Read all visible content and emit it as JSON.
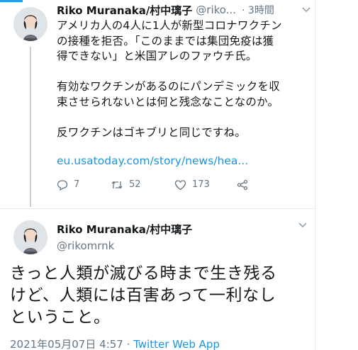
{
  "accent_color": "#1da1f2",
  "link_color": "#1b95e0",
  "tweet1": {
    "author_name": "Riko Muranaka/村中璃子",
    "author_handle": "@riko...",
    "timestamp": "· 3時間",
    "avatar_icon": "avatar-icon",
    "lines": [
      "アメリカ人の4人に1人が新型コロナワクチン",
      "の接種を拒否。「このままでは集団免疫は獲",
      "得できない」と米国アレのファウチ氏。"
    ],
    "lines2": [
      "有効なワクチンがあるのにパンデミックを収",
      "束させられないとは何と残念なことなのか。"
    ],
    "line3": "反ワクチンはゴキブリと同じですね。",
    "link": "eu.usatoday.com/story/news/hea...",
    "reply_count": "7",
    "retweet_count": "52",
    "like_count": "173"
  },
  "tweet2": {
    "author_name": "Riko Muranaka/村中璃子",
    "author_handle": "@rikomrnk",
    "lines": [
      "きっと人類が滅びる時まで生き残る",
      "けど、人類には百害あって一利なし",
      "ということ。"
    ],
    "date": "2021年05月07日 4:57 · ",
    "source": "Twitter Web App"
  }
}
